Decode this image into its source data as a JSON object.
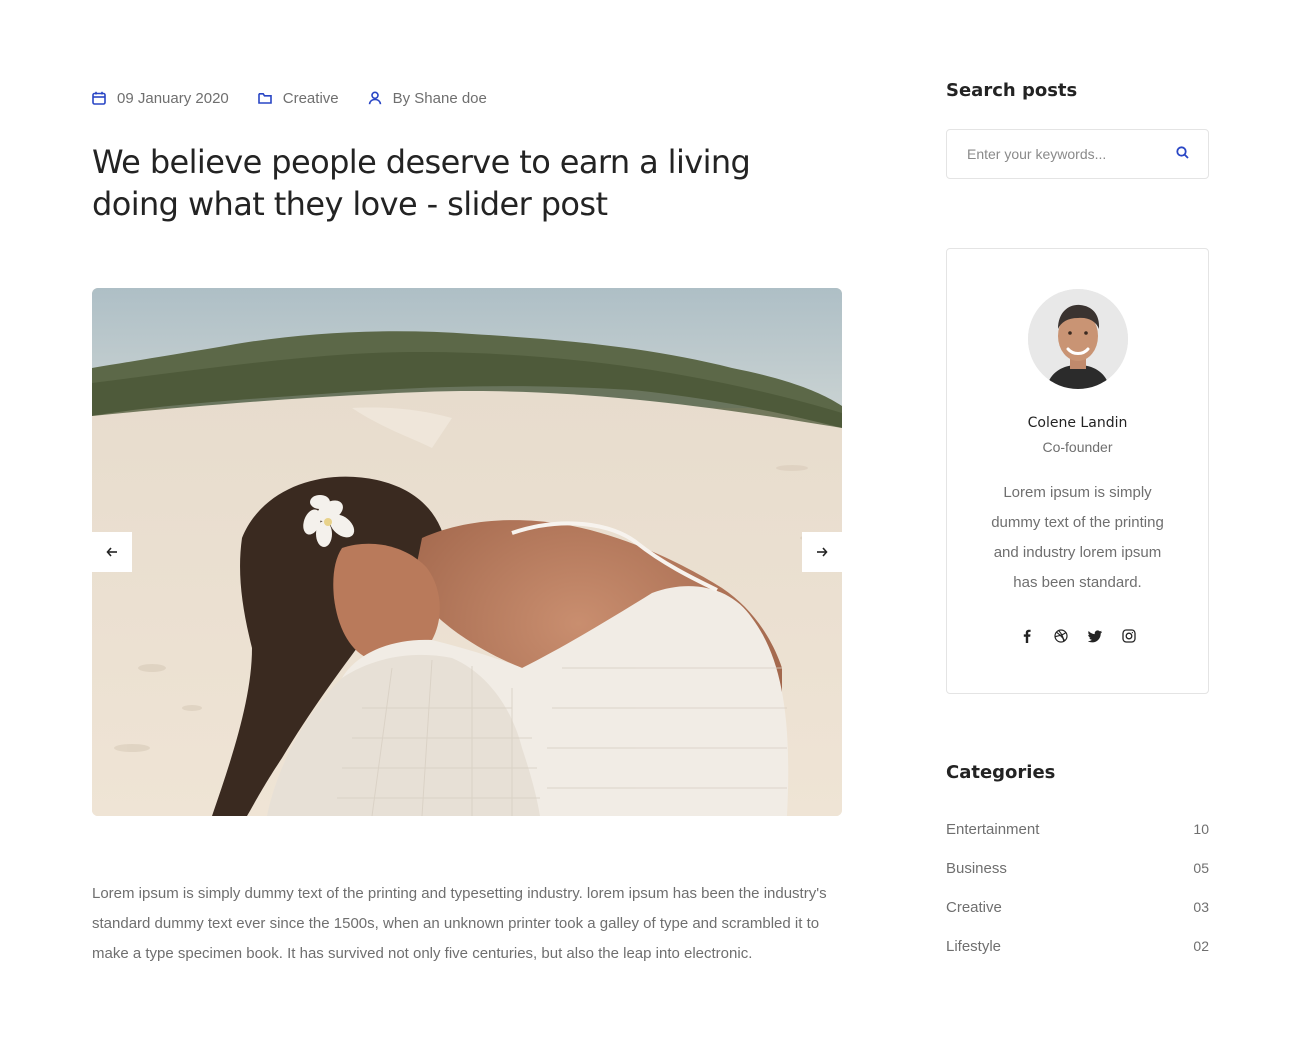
{
  "meta": {
    "date": "09 January 2020",
    "category": "Creative",
    "author": "By Shane doe"
  },
  "post": {
    "title": "We believe people deserve to earn a living doing what they love - slider post",
    "body": "Lorem ipsum is simply dummy text of the printing and typesetting industry. lorem ipsum has been the industry's standard dummy text ever since the 1500s, when an unknown printer took a galley of type and scrambled it to make a type specimen book. It has survived not only five centuries, but also the leap into electronic."
  },
  "sidebar": {
    "search": {
      "title": "Search posts",
      "placeholder": "Enter your keywords..."
    },
    "author": {
      "name": "Colene Landin",
      "role": "Co-founder",
      "bio": "Lorem ipsum is simply dummy text of the printing and industry lorem ipsum has been standard.",
      "socials": [
        "facebook-icon",
        "dribbble-icon",
        "twitter-icon",
        "instagram-icon"
      ]
    },
    "categories": {
      "title": "Categories",
      "items": [
        {
          "label": "Entertainment",
          "count": "10"
        },
        {
          "label": "Business",
          "count": "05"
        },
        {
          "label": "Creative",
          "count": "03"
        },
        {
          "label": "Lifestyle",
          "count": "02"
        }
      ]
    }
  },
  "colors": {
    "accent": "#2946c5",
    "text": "#232323",
    "muted": "#6f6f6f",
    "border": "#e4e4e4"
  }
}
